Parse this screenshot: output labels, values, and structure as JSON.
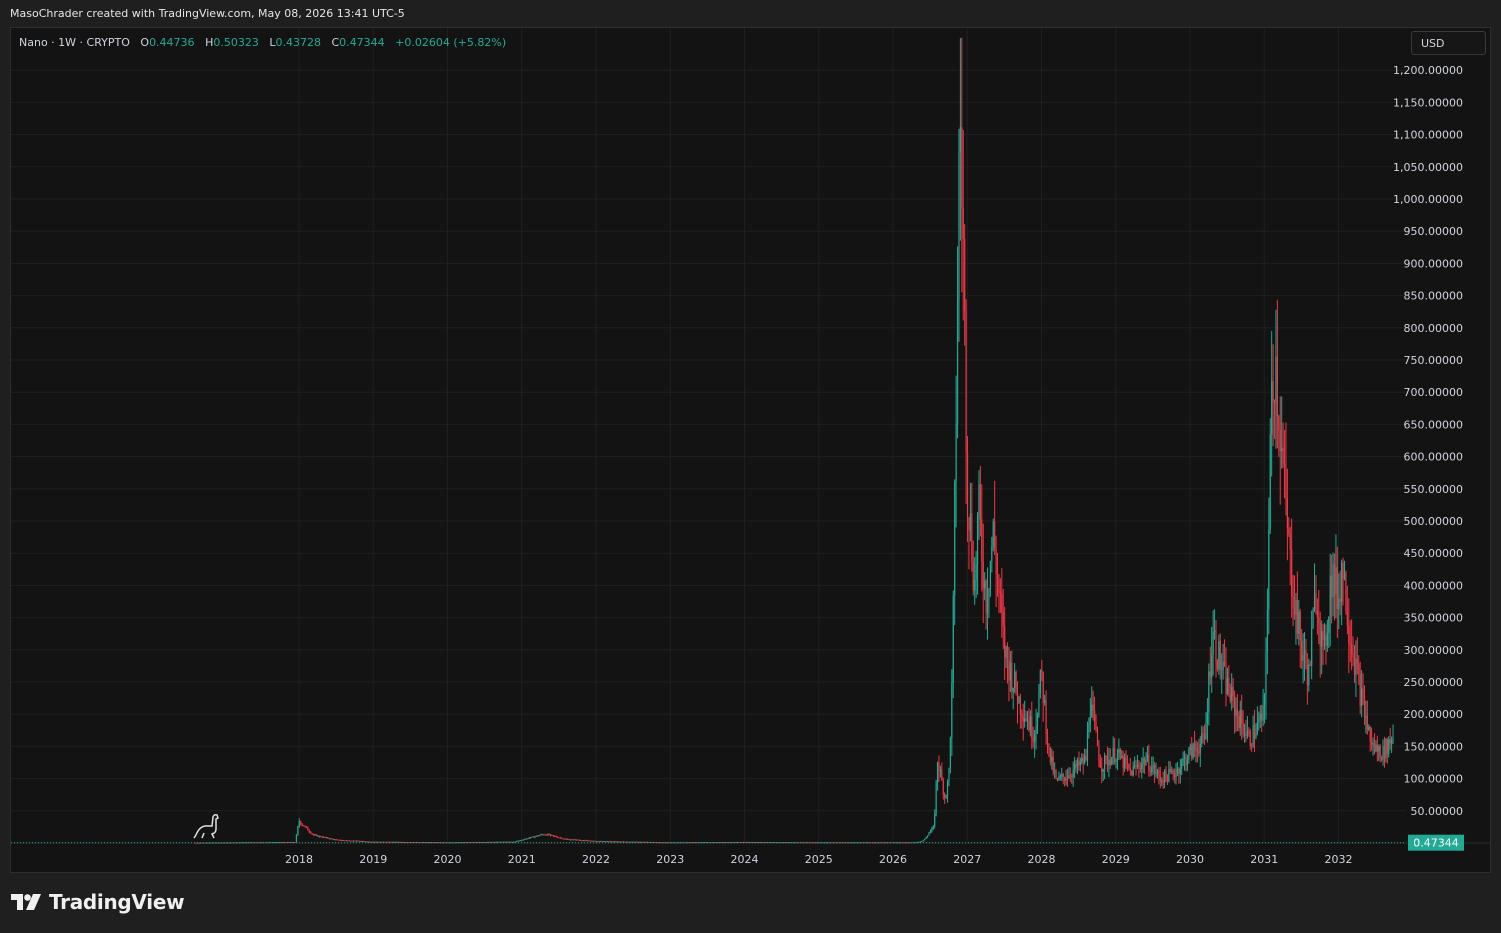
{
  "header": {
    "text": "MasoChrader created with TradingView.com, May 08, 2026 13:41 UTC-5"
  },
  "legend": {
    "symbol": "Nano · 1W · CRYPTO",
    "open_label": "O",
    "open": "0.44736",
    "high_label": "H",
    "high": "0.50323",
    "low_label": "L",
    "low": "0.43728",
    "close_label": "C",
    "close": "0.47344",
    "change": "+0.02604 (+5.82%)"
  },
  "currency": "USD",
  "last_price_label": "0.47344",
  "brand": "TradingView",
  "colors": {
    "up": "#22ab94",
    "down": "#f23645",
    "background": "#131313",
    "grid": "#1f1f1f"
  },
  "chart_data": {
    "type": "candlestick",
    "ylim": [
      0,
      1250
    ],
    "y_ticks": [
      "50.00000",
      "100.00000",
      "150.00000",
      "200.00000",
      "250.00000",
      "300.00000",
      "350.00000",
      "400.00000",
      "450.00000",
      "500.00000",
      "550.00000",
      "600.00000",
      "650.00000",
      "700.00000",
      "750.00000",
      "800.00000",
      "850.00000",
      "900.00000",
      "950.00000",
      "1,000.00000",
      "1,050.00000",
      "1,100.00000",
      "1,150.00000",
      "1,200.00000"
    ],
    "x_ticks": [
      "2018",
      "2019",
      "2020",
      "2021",
      "2022",
      "2023",
      "2024",
      "2025",
      "2026",
      "2027",
      "2028",
      "2029",
      "2030",
      "2031",
      "2032"
    ],
    "last_price": 0.47344,
    "price_path": [
      [
        2016.6,
        0.5
      ],
      [
        2017.95,
        1.5
      ],
      [
        2018.0,
        35
      ],
      [
        2018.05,
        28
      ],
      [
        2018.2,
        12
      ],
      [
        2018.5,
        5
      ],
      [
        2019.0,
        2
      ],
      [
        2020.0,
        1
      ],
      [
        2020.9,
        2
      ],
      [
        2021.3,
        14
      ],
      [
        2021.6,
        6
      ],
      [
        2022.0,
        3
      ],
      [
        2023.0,
        1
      ],
      [
        2024.0,
        1.5
      ],
      [
        2025.0,
        1
      ],
      [
        2026.3,
        1
      ],
      [
        2026.4,
        3
      ],
      [
        2026.55,
        25
      ],
      [
        2026.6,
        130
      ],
      [
        2026.7,
        70
      ],
      [
        2026.75,
        100
      ],
      [
        2026.8,
        260
      ],
      [
        2026.85,
        680
      ],
      [
        2026.9,
        1150
      ],
      [
        2026.95,
        900
      ],
      [
        2027.0,
        560
      ],
      [
        2027.1,
        400
      ],
      [
        2027.15,
        520
      ],
      [
        2027.25,
        380
      ],
      [
        2027.35,
        480
      ],
      [
        2027.5,
        300
      ],
      [
        2027.7,
        220
      ],
      [
        2027.9,
        170
      ],
      [
        2028.0,
        260
      ],
      [
        2028.1,
        140
      ],
      [
        2028.2,
        95
      ],
      [
        2028.4,
        110
      ],
      [
        2028.6,
        130
      ],
      [
        2028.65,
        220
      ],
      [
        2028.8,
        120
      ],
      [
        2029.0,
        140
      ],
      [
        2029.2,
        110
      ],
      [
        2029.4,
        130
      ],
      [
        2029.6,
        100
      ],
      [
        2029.8,
        110
      ],
      [
        2030.0,
        140
      ],
      [
        2030.2,
        160
      ],
      [
        2030.3,
        330
      ],
      [
        2030.45,
        260
      ],
      [
        2030.6,
        210
      ],
      [
        2030.8,
        160
      ],
      [
        2031.0,
        200
      ],
      [
        2031.05,
        420
      ],
      [
        2031.1,
        700
      ],
      [
        2031.15,
        760
      ],
      [
        2031.25,
        580
      ],
      [
        2031.35,
        430
      ],
      [
        2031.5,
        300
      ],
      [
        2031.6,
        260
      ],
      [
        2031.7,
        400
      ],
      [
        2031.8,
        280
      ],
      [
        2031.9,
        420
      ],
      [
        2032.0,
        380
      ],
      [
        2032.05,
        440
      ],
      [
        2032.15,
        330
      ],
      [
        2032.3,
        230
      ],
      [
        2032.45,
        150
      ],
      [
        2032.6,
        140
      ],
      [
        2032.75,
        170
      ]
    ]
  }
}
